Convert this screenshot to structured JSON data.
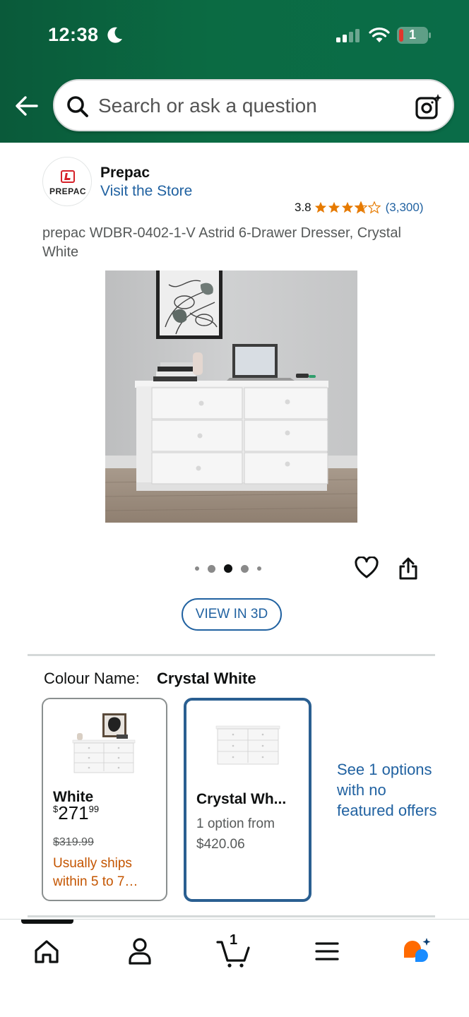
{
  "status_bar": {
    "time": "12:38",
    "battery_level": "1"
  },
  "header": {
    "search_placeholder": "Search or ask a question"
  },
  "brand": {
    "logo_text": "PREPAC",
    "name": "Prepac",
    "visit_store": "Visit the Store"
  },
  "rating": {
    "value": "3.8",
    "stars_filled": 3.8,
    "count": "(3,300)",
    "star_color": "#e67a00"
  },
  "product": {
    "title": "prepac WDBR-0402-1-V Astrid 6-Drawer Dresser, Crystal White",
    "image_dots": {
      "count": 5,
      "active_index": 2
    },
    "view3d_label": "VIEW IN 3D"
  },
  "colour": {
    "label": "Colour Name:",
    "selected": "Crystal White",
    "swatches": [
      {
        "name": "White",
        "price_symbol": "$",
        "price_whole": "271",
        "price_fraction": "99",
        "list_price": "$319.99",
        "shipping": "Usually ships within 5 to 7…",
        "selected": false
      },
      {
        "name": "Crystal Wh...",
        "options_line1": "1 option from",
        "options_line2": "$420.06",
        "selected": true
      }
    ],
    "see_options": "See 1 options with no featured offers"
  },
  "bottom_nav": {
    "items": [
      "home-icon",
      "account-icon",
      "cart-icon",
      "menu-icon",
      "rufus-icon"
    ],
    "cart_count": "1",
    "active": "home",
    "accent_colors": {
      "rufus_orange": "#ff6a00",
      "rufus_blue": "#1a8cff"
    }
  },
  "colors": {
    "header_green": "#0b6b43",
    "link_blue": "#2162a1",
    "ships_orange": "#c45500"
  }
}
